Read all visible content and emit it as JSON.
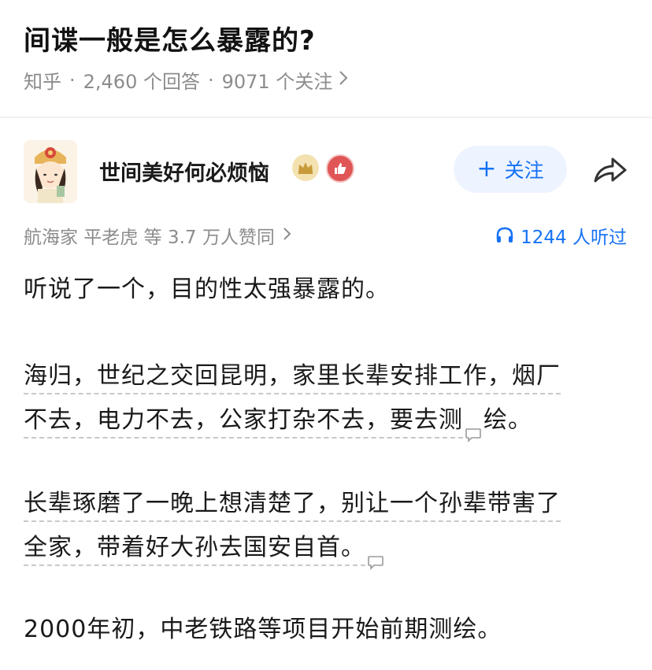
{
  "question": {
    "title": "间谍一般是怎么暴露的?",
    "source": "知乎",
    "answers_count": "2,460 个回答",
    "followers_count": "9071 个关注",
    "separator": "·"
  },
  "author": {
    "name": "世间美好何必烦恼",
    "follow_label": "关注",
    "icons": [
      "avatar",
      "crown-badge-icon",
      "thumb-badge-icon",
      "share-icon"
    ]
  },
  "stats": {
    "voters": "航海家 平老虎 等 3.7 万人赞同",
    "listened": "1244 人听过"
  },
  "content": {
    "p1": "听说了一个，目的性太强暴露的。",
    "p2_line1": "海归，世纪之交回昆明，家里长辈安排工作，烟厂",
    "p2_line2_a": "不去，电力不去，公家打杂不去，要去测",
    "p2_line2_b": "绘。",
    "p3_line1": "长辈琢磨了一晚上想清楚了，别让一个孙辈带害了",
    "p3_line2": "全家，带着好大孙去国安自首。",
    "p4": "2000年初，中老铁路等项目开始前期测绘。"
  },
  "colors": {
    "accent": "#1772f6",
    "muted": "#8c8c8c",
    "follow_bg": "#eef4ff"
  }
}
